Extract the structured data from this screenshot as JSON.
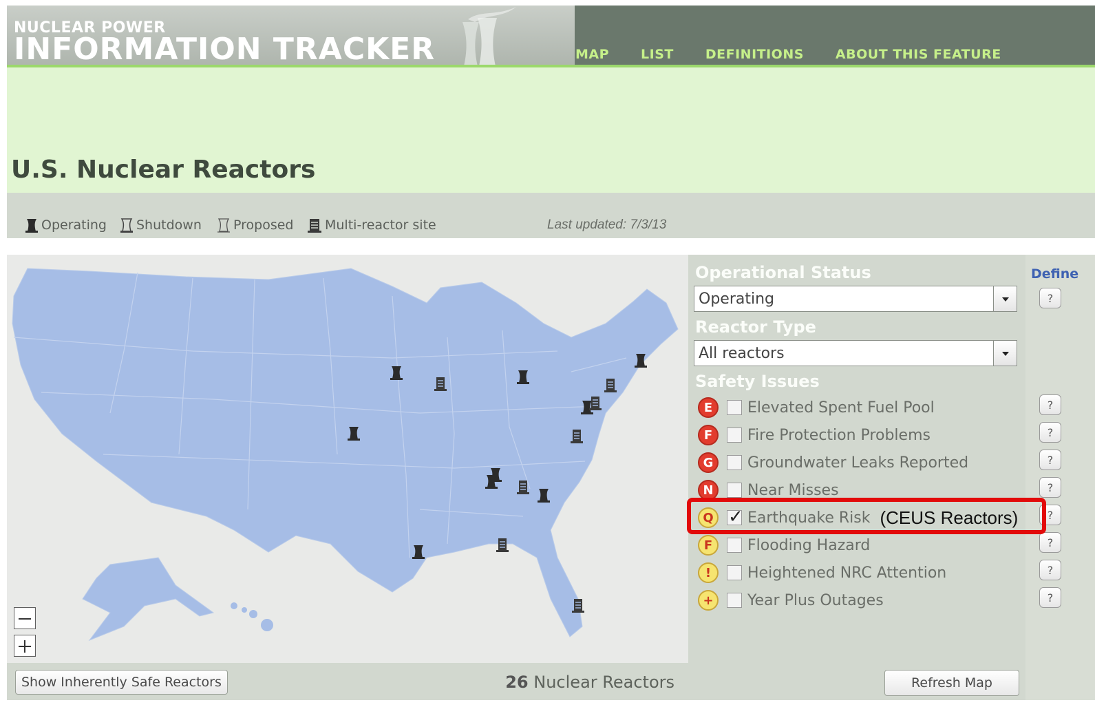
{
  "header": {
    "brand_small": "NUCLEAR POWER",
    "brand_big": "INFORMATION TRACKER",
    "nav": [
      "MAP",
      "LIST",
      "DEFINITIONS",
      "ABOUT THIS FEATURE"
    ]
  },
  "page_title": "U.S. Nuclear Reactors",
  "legend": {
    "items": [
      "Operating",
      "Shutdown",
      "Proposed",
      "Multi-reactor site"
    ],
    "last_updated": "Last updated: 7/3/13"
  },
  "map": {
    "show_safe_button": "Show Inherently Safe Reactors",
    "count_number": "26",
    "count_text": " Nuclear Reactors",
    "markers_single": 10,
    "markers_multi": 8
  },
  "filters": {
    "operational_status_heading": "Operational Status",
    "operational_status_value": "Operating",
    "reactor_type_heading": "Reactor Type",
    "reactor_type_value": "All reactors",
    "safety_issues_heading": "Safety Issues",
    "issues": [
      {
        "badge": "E",
        "label": "Elevated Spent Fuel Pool",
        "checked": false,
        "color": "red"
      },
      {
        "badge": "F",
        "label": "Fire Protection Problems",
        "checked": false,
        "color": "red"
      },
      {
        "badge": "G",
        "label": "Groundwater Leaks Reported",
        "checked": false,
        "color": "red"
      },
      {
        "badge": "N",
        "label": "Near Misses",
        "checked": false,
        "color": "red"
      },
      {
        "badge": "Q",
        "label": "Earthquake Risk",
        "checked": true,
        "color": "yellow"
      },
      {
        "badge": "F",
        "label": "Flooding Hazard",
        "checked": false,
        "color": "yellow"
      },
      {
        "badge": "!",
        "label": "Heightened NRC Attention",
        "checked": false,
        "color": "yellow"
      },
      {
        "badge": "+",
        "label": "Year Plus Outages",
        "checked": false,
        "color": "yellow"
      }
    ],
    "ceus_note": "(CEUS Reactors)",
    "refresh_button": "Refresh Map"
  },
  "define": {
    "header": "Define",
    "help_label": "?"
  },
  "colors": {
    "header_bg": "#6a786c",
    "nav_text": "#c6f08a",
    "title_band": "#e1f5d2",
    "panel_bg": "#d2d8cf",
    "map_land": "#a6bde6",
    "highlight": "#e20a0a"
  }
}
